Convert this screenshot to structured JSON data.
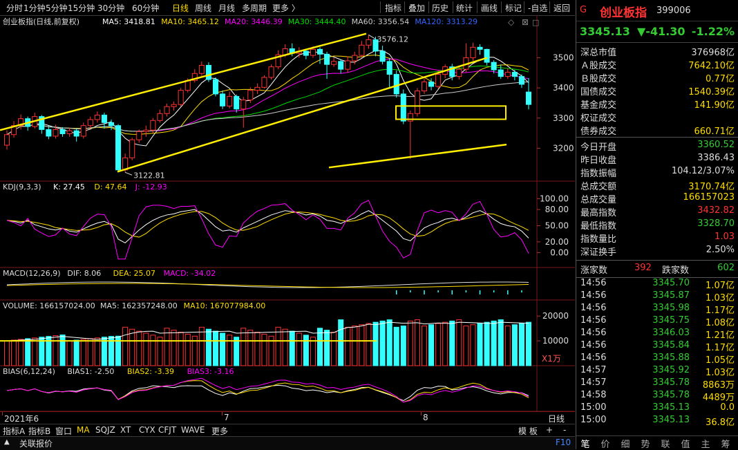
{
  "toolbar": {
    "periods": [
      "分时",
      "1分钟",
      "5分钟",
      "15分钟",
      "30分钟",
      "60分钟",
      "日线",
      "周线",
      "月线",
      "多周期",
      "更多 〉"
    ],
    "active_period": "日线",
    "tools": [
      "指标",
      "叠加",
      "历史",
      "统计",
      "画线",
      "标记",
      "-自选",
      "返回"
    ]
  },
  "main_panel": {
    "title": "创业板指(日线,前复权)",
    "ma_labels": [
      "MA5: 3418.81",
      "MA10: 3465.12",
      "MA20: 3446.39",
      "MA30: 3444.40",
      "MA60: 3356.54",
      "MA120: 3313.29"
    ],
    "ma_colors": [
      "#ffffff",
      "#ffdd00",
      "#ff00ff",
      "#00dd00",
      "#cccccc",
      "#3366ff"
    ],
    "price_ticks": [
      "3500",
      "3400",
      "3300",
      "3200"
    ],
    "high_label": "3576.12",
    "low_label": "3122.81"
  },
  "kdj_panel": {
    "title": "KDJ(9,3,3)",
    "k": "K: 27.45",
    "d": "D: 47.64",
    "j": "J: -12.93",
    "ticks": [
      "100.00",
      "80.00",
      "50.00",
      "20.00",
      "0.00"
    ]
  },
  "macd_panel": {
    "title": "MACD(12,26,9)",
    "dif": "DIF: 8.06",
    "dea": "DEA: 25.07",
    "macd": "MACD: -34.02"
  },
  "volume_panel": {
    "title": "VOLUME: 166157024.00",
    "ma5": "MA5: 162357248.00",
    "ma10": "MA10: 167077984.00",
    "ticks": [
      "20000",
      "10000"
    ],
    "unit": "X1万"
  },
  "bias_panel": {
    "title": "BIAS(6,12,24)",
    "bias1": "BIAS1: -2.50",
    "bias2": "BIAS2: -3.39",
    "bias3": "BIAS3: -3.16"
  },
  "x_axis": {
    "labels": [
      "2021年6",
      "7",
      "8"
    ],
    "period": "日线"
  },
  "bottom_tabs": [
    "指标A",
    "指标B",
    "窗口",
    "MA",
    "SQJZ",
    "XT",
    "CYX",
    "CFJT",
    "WAVE",
    "更多"
  ],
  "bottom_right": {
    "template": "模 板",
    "plus": "+",
    "minus": "-",
    "f10": "F10"
  },
  "status": {
    "quote_report": "关联报价"
  },
  "quote": {
    "marker": "G",
    "name": "创业板指",
    "code": "399006",
    "price": "3345.13",
    "change": "▼-41.30",
    "change_pct": "-1.22%"
  },
  "stats_top": [
    {
      "label": "深总市值",
      "value": "376968亿",
      "color": "white"
    },
    {
      "label": "Ａ股成交",
      "value": "7642.10亿",
      "color": "yellow"
    },
    {
      "label": "Ｂ股成交",
      "value": "0.77亿",
      "color": "yellow"
    },
    {
      "label": "国债成交",
      "value": "1540.39亿",
      "color": "yellow"
    },
    {
      "label": "基金成交",
      "value": "141.90亿",
      "color": "yellow"
    },
    {
      "label": "权证成交",
      "value": "",
      "color": "yellow"
    },
    {
      "label": "债券成交",
      "value": "660.71亿",
      "color": "yellow"
    }
  ],
  "stats_bottom": [
    {
      "label": "今日开盘",
      "value": "3360.52",
      "color": "green"
    },
    {
      "label": "昨日收盘",
      "value": "3386.43",
      "color": "white"
    },
    {
      "label": "指数振幅",
      "value": "104.12/3.07%",
      "color": "white"
    },
    {
      "label": "总成交额",
      "value": "3170.74亿",
      "color": "yellow"
    },
    {
      "label": "总成交量",
      "value": "166157023",
      "color": "yellow"
    },
    {
      "label": "最高指数",
      "value": "3432.82",
      "color": "red"
    },
    {
      "label": "最低指数",
      "value": "3328.70",
      "color": "green"
    },
    {
      "label": "指数量比",
      "value": "1.03",
      "color": "red"
    },
    {
      "label": "深证换手",
      "value": "2.50%",
      "color": "white"
    }
  ],
  "breadth": {
    "up_label": "涨家数",
    "up": "392",
    "down_label": "跌家数",
    "down": "602"
  },
  "ticks": [
    {
      "t": "14:56",
      "p": "3345.70",
      "v": "1.07亿"
    },
    {
      "t": "14:56",
      "p": "3345.87",
      "v": "1.03亿"
    },
    {
      "t": "14:56",
      "p": "3345.98",
      "v": "1.17亿"
    },
    {
      "t": "14:56",
      "p": "3345.75",
      "v": "1.08亿"
    },
    {
      "t": "14:56",
      "p": "3346.03",
      "v": "1.21亿"
    },
    {
      "t": "14:56",
      "p": "3345.84",
      "v": "1.17亿"
    },
    {
      "t": "14:56",
      "p": "3345.88",
      "v": "1.05亿"
    },
    {
      "t": "14:57",
      "p": "3345.92",
      "v": "1.03亿"
    },
    {
      "t": "14:57",
      "p": "3345.78",
      "v": "8863万"
    },
    {
      "t": "14:58",
      "p": "3345.78",
      "v": "4489万"
    },
    {
      "t": "15:00",
      "p": "3345.13",
      "v": "0.0"
    },
    {
      "t": "15:00",
      "p": "3345.13",
      "v": "36.8亿"
    }
  ],
  "right_tabs": [
    "笔",
    "价",
    "细",
    "势",
    "联",
    "值",
    "主",
    "筹"
  ],
  "chart_data": {
    "type": "candlestick",
    "title": "创业板指(日线,前复权)",
    "ylim": [
      3100,
      3600
    ],
    "candles": [
      {
        "o": 3210,
        "c": 3245,
        "h": 3260,
        "l": 3195
      },
      {
        "o": 3245,
        "c": 3275,
        "h": 3290,
        "l": 3235
      },
      {
        "o": 3275,
        "c": 3298,
        "h": 3312,
        "l": 3262
      },
      {
        "o": 3298,
        "c": 3272,
        "h": 3305,
        "l": 3258
      },
      {
        "o": 3272,
        "c": 3305,
        "h": 3318,
        "l": 3265
      },
      {
        "o": 3305,
        "c": 3262,
        "h": 3310,
        "l": 3248
      },
      {
        "o": 3262,
        "c": 3240,
        "h": 3275,
        "l": 3230
      },
      {
        "o": 3240,
        "c": 3262,
        "h": 3278,
        "l": 3232
      },
      {
        "o": 3262,
        "c": 3248,
        "h": 3270,
        "l": 3238
      },
      {
        "o": 3248,
        "c": 3258,
        "h": 3268,
        "l": 3238
      },
      {
        "o": 3258,
        "c": 3240,
        "h": 3266,
        "l": 3222
      },
      {
        "o": 3240,
        "c": 3275,
        "h": 3285,
        "l": 3232
      },
      {
        "o": 3275,
        "c": 3295,
        "h": 3305,
        "l": 3265
      },
      {
        "o": 3295,
        "c": 3310,
        "h": 3322,
        "l": 3285
      },
      {
        "o": 3310,
        "c": 3285,
        "h": 3318,
        "l": 3265
      },
      {
        "o": 3285,
        "c": 3275,
        "h": 3295,
        "l": 3260
      },
      {
        "o": 3275,
        "c": 3128,
        "h": 3280,
        "l": 3122.81
      },
      {
        "o": 3128,
        "c": 3168,
        "h": 3182,
        "l": 3120
      },
      {
        "o": 3168,
        "c": 3228,
        "h": 3235,
        "l": 3160
      },
      {
        "o": 3228,
        "c": 3255,
        "h": 3262,
        "l": 3218
      },
      {
        "o": 3255,
        "c": 3260,
        "h": 3275,
        "l": 3238
      },
      {
        "o": 3260,
        "c": 3292,
        "h": 3300,
        "l": 3250
      },
      {
        "o": 3292,
        "c": 3315,
        "h": 3328,
        "l": 3285
      },
      {
        "o": 3315,
        "c": 3338,
        "h": 3348,
        "l": 3305
      },
      {
        "o": 3338,
        "c": 3345,
        "h": 3355,
        "l": 3325
      },
      {
        "o": 3345,
        "c": 3392,
        "h": 3400,
        "l": 3338
      },
      {
        "o": 3392,
        "c": 3425,
        "h": 3432,
        "l": 3385
      },
      {
        "o": 3425,
        "c": 3448,
        "h": 3462,
        "l": 3418
      },
      {
        "o": 3448,
        "c": 3475,
        "h": 3488,
        "l": 3440
      },
      {
        "o": 3475,
        "c": 3428,
        "h": 3485,
        "l": 3420
      },
      {
        "o": 3428,
        "c": 3380,
        "h": 3435,
        "l": 3372
      },
      {
        "o": 3380,
        "c": 3340,
        "h": 3392,
        "l": 3330
      },
      {
        "o": 3340,
        "c": 3372,
        "h": 3388,
        "l": 3332
      },
      {
        "o": 3372,
        "c": 3330,
        "h": 3378,
        "l": 3318
      },
      {
        "o": 3330,
        "c": 3360,
        "h": 3370,
        "l": 3268
      },
      {
        "o": 3360,
        "c": 3392,
        "h": 3402,
        "l": 3350
      },
      {
        "o": 3392,
        "c": 3402,
        "h": 3415,
        "l": 3380
      },
      {
        "o": 3402,
        "c": 3435,
        "h": 3442,
        "l": 3398
      },
      {
        "o": 3435,
        "c": 3470,
        "h": 3478,
        "l": 3428
      },
      {
        "o": 3470,
        "c": 3510,
        "h": 3525,
        "l": 3462
      },
      {
        "o": 3510,
        "c": 3530,
        "h": 3545,
        "l": 3502
      },
      {
        "o": 3530,
        "c": 3515,
        "h": 3548,
        "l": 3505
      },
      {
        "o": 3515,
        "c": 3522,
        "h": 3535,
        "l": 3500
      },
      {
        "o": 3522,
        "c": 3508,
        "h": 3530,
        "l": 3495
      },
      {
        "o": 3508,
        "c": 3528,
        "h": 3538,
        "l": 3500
      },
      {
        "o": 3528,
        "c": 3512,
        "h": 3535,
        "l": 3480
      },
      {
        "o": 3512,
        "c": 3478,
        "h": 3520,
        "l": 3430
      },
      {
        "o": 3478,
        "c": 3488,
        "h": 3500,
        "l": 3470
      },
      {
        "o": 3488,
        "c": 3462,
        "h": 3495,
        "l": 3448
      },
      {
        "o": 3462,
        "c": 3490,
        "h": 3505,
        "l": 3450
      },
      {
        "o": 3490,
        "c": 3508,
        "h": 3520,
        "l": 3478
      },
      {
        "o": 3508,
        "c": 3542,
        "h": 3556,
        "l": 3500
      },
      {
        "o": 3542,
        "c": 3560,
        "h": 3576.12,
        "l": 3530
      },
      {
        "o": 3560,
        "c": 3522,
        "h": 3570,
        "l": 3505
      },
      {
        "o": 3522,
        "c": 3488,
        "h": 3540,
        "l": 3478
      },
      {
        "o": 3488,
        "c": 3445,
        "h": 3498,
        "l": 3400
      },
      {
        "o": 3445,
        "c": 3380,
        "h": 3458,
        "l": 3368
      },
      {
        "o": 3380,
        "c": 3290,
        "h": 3395,
        "l": 3280
      },
      {
        "o": 3290,
        "c": 3315,
        "h": 3325,
        "l": 3165
      },
      {
        "o": 3315,
        "c": 3390,
        "h": 3400,
        "l": 3305
      },
      {
        "o": 3390,
        "c": 3420,
        "h": 3432,
        "l": 3380
      },
      {
        "o": 3420,
        "c": 3405,
        "h": 3432,
        "l": 3392
      },
      {
        "o": 3405,
        "c": 3445,
        "h": 3458,
        "l": 3398
      },
      {
        "o": 3445,
        "c": 3470,
        "h": 3478,
        "l": 3432
      },
      {
        "o": 3470,
        "c": 3438,
        "h": 3480,
        "l": 3425
      },
      {
        "o": 3438,
        "c": 3462,
        "h": 3472,
        "l": 3428
      },
      {
        "o": 3462,
        "c": 3500,
        "h": 3548,
        "l": 3452
      },
      {
        "o": 3500,
        "c": 3535,
        "h": 3550,
        "l": 3490
      },
      {
        "o": 3535,
        "c": 3528,
        "h": 3545,
        "l": 3510
      },
      {
        "o": 3528,
        "c": 3485,
        "h": 3530,
        "l": 3475
      },
      {
        "o": 3485,
        "c": 3460,
        "h": 3492,
        "l": 3448
      },
      {
        "o": 3460,
        "c": 3438,
        "h": 3478,
        "l": 3430
      },
      {
        "o": 3438,
        "c": 3452,
        "h": 3465,
        "l": 3430
      },
      {
        "o": 3452,
        "c": 3438,
        "h": 3460,
        "l": 3425
      },
      {
        "o": 3438,
        "c": 3412,
        "h": 3445,
        "l": 3400
      },
      {
        "o": 3386.43,
        "c": 3345.13,
        "h": 3432.82,
        "l": 3328.7
      }
    ],
    "ma_series": [
      {
        "name": "MA5",
        "last": 3418.81
      },
      {
        "name": "MA10",
        "last": 3465.12
      },
      {
        "name": "MA20",
        "last": 3446.39
      },
      {
        "name": "MA30",
        "last": 3444.4
      },
      {
        "name": "MA60",
        "last": 3356.54
      },
      {
        "name": "MA120",
        "last": 3313.29
      }
    ],
    "kdj": {
      "K": 27.45,
      "D": 47.64,
      "J": -12.93
    },
    "macd": {
      "DIF": 8.06,
      "DEA": 25.07,
      "MACD": -34.02
    },
    "volume_last": 166157024,
    "bias": {
      "BIAS1": -2.5,
      "BIAS2": -3.39,
      "BIAS3": -3.16
    }
  }
}
